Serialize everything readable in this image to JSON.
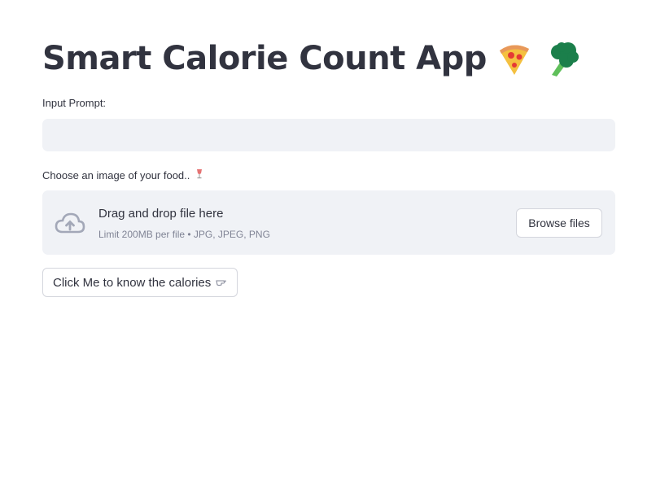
{
  "header": {
    "title": "Smart Calorie Count App",
    "icons": [
      "pizza-icon",
      "broccoli-icon"
    ]
  },
  "prompt": {
    "label": "Input Prompt:",
    "value": "",
    "placeholder": ""
  },
  "uploader": {
    "label": "Choose an image of your food..",
    "label_icon": "wine-glass-icon",
    "drop_text": "Drag and drop file here",
    "limit_text": "Limit 200MB per file • JPG, JPEG, PNG",
    "browse_label": "Browse files"
  },
  "action": {
    "label": "Click Me to know the calories",
    "icon": "pointing-hand-icon"
  },
  "colors": {
    "text": "#31333f",
    "input_bg": "#f0f2f6",
    "muted": "#808495",
    "icon_gray": "#a3a8b8"
  }
}
